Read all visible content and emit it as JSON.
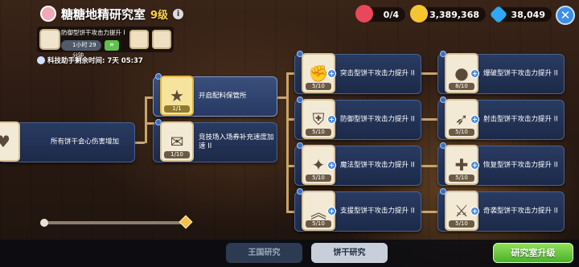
{
  "header": {
    "title": "糖糖地精研究室",
    "level": "9级",
    "info_icon": "info-icon"
  },
  "resources": {
    "cookie_count": "0/4",
    "coins": "3,389,368",
    "gems": "38,049"
  },
  "research_box": {
    "current_name": "防御型饼干攻击力提升 I",
    "time_left": "1小时 29分钟"
  },
  "assist": {
    "label": "科技助手剩余时间:",
    "value": "7天 05:37"
  },
  "nodes": [
    {
      "label": "所有饼干会心伤害增加",
      "progress": "",
      "icon": "heart-icon"
    },
    {
      "label": "开启配料保管所",
      "progress": "1/1",
      "icon": "star-box-icon"
    },
    {
      "label": "竞技场入场券补充速度加速 II",
      "progress": "1/10",
      "icon": "ticket-icon"
    },
    {
      "label": "突击型饼干攻击力提升 II",
      "progress": "5/10",
      "icon": "fist-icon"
    },
    {
      "label": "防御型饼干攻击力提升 II",
      "progress": "5/10",
      "icon": "shield-icon"
    },
    {
      "label": "魔法型饼干攻击力提升 II",
      "progress": "5/10",
      "icon": "wand-icon"
    },
    {
      "label": "支援型饼干攻击力提升 II",
      "progress": "5/10",
      "icon": "chevrons-icon"
    },
    {
      "label": "爆破型饼干攻击力提升 II",
      "progress": "8/10",
      "icon": "bomb-icon"
    },
    {
      "label": "射击型饼干攻击力提升 II",
      "progress": "5/10",
      "icon": "crossbow-icon"
    },
    {
      "label": "恢复型饼干攻击力提升 II",
      "progress": "5/10",
      "icon": "cross-icon"
    },
    {
      "label": "奇袭型饼干攻击力提升 II",
      "progress": "5/10",
      "icon": "blade-icon"
    }
  ],
  "tabs": {
    "kingdom": "王国研究",
    "cookie": "饼干研究"
  },
  "upgrade_button": "研究室升级",
  "colors": {
    "node_bg": "#2a3b62",
    "accent_gold": "#f4c04a",
    "upgrade_green": "#4cb12c"
  }
}
